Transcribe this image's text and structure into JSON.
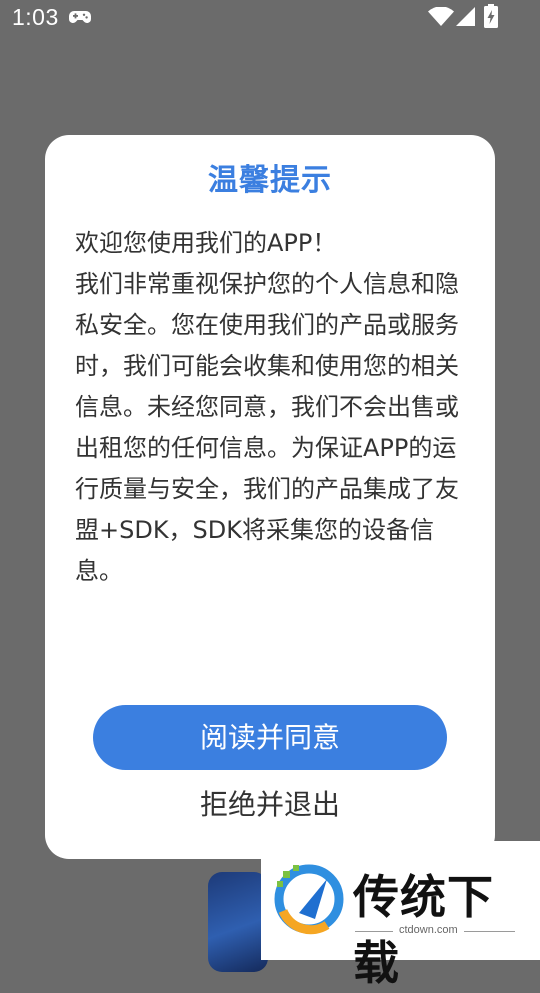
{
  "status_bar": {
    "time": "1:03",
    "icons": [
      "gamepad-icon",
      "wifi-icon",
      "signal-icon",
      "battery-charging-icon"
    ]
  },
  "dialog": {
    "title": "温馨提示",
    "paragraphs": [
      "欢迎您使用我们的APP！",
      "我们非常重视保护您的个人信息和隐私安全。您在使用我们的产品或服务时，我们可能会收集和使用您的相关信息。未经您同意，我们不会出售或出租您的任何信息。为保证APP的运行质量与安全，我们的产品集成了友盟+SDK，SDK将采集您的设备信息。"
    ],
    "agree_label": "阅读并同意",
    "refuse_label": "拒绝并退出"
  },
  "watermark": {
    "name": "传统下载",
    "domain": "ctdown.com"
  },
  "colors": {
    "accent": "#3b7fe0",
    "overlay": "#6b6b6b",
    "body_text": "#333333"
  }
}
